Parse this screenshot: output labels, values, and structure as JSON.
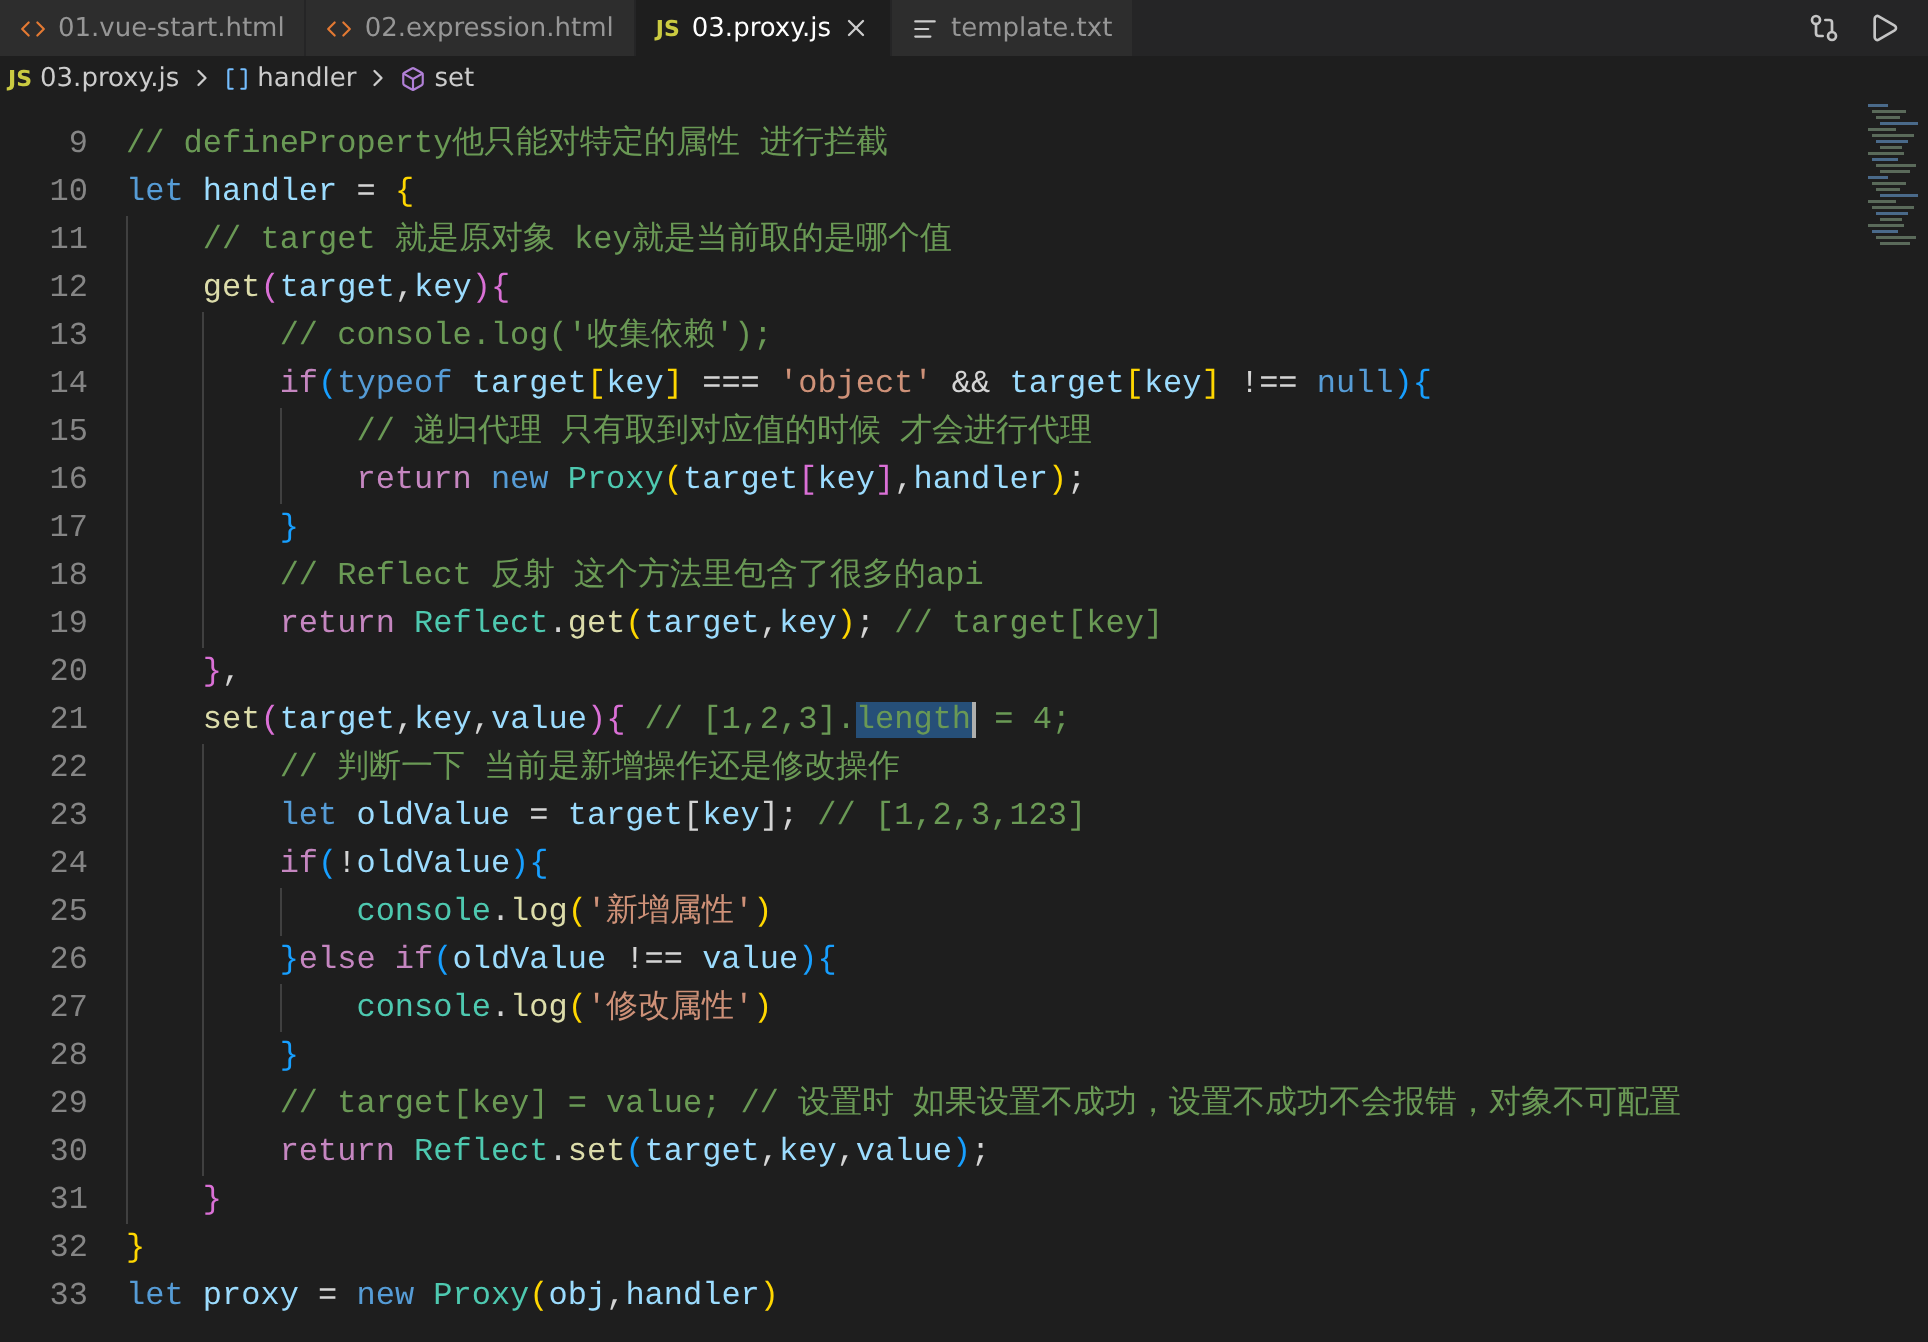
{
  "tabs": [
    {
      "kind": "html",
      "label": "01.vue-start.html",
      "selected": false
    },
    {
      "kind": "html",
      "label": "02.expression.html",
      "selected": false
    },
    {
      "kind": "js",
      "icon_text": "JS",
      "label": "03.proxy.js",
      "selected": true
    },
    {
      "kind": "txt",
      "label": "template.txt",
      "selected": false
    }
  ],
  "breadcrumb": [
    {
      "kind": "file",
      "icon_text": "JS",
      "label": "03.proxy.js"
    },
    {
      "kind": "variable",
      "label": "handler"
    },
    {
      "kind": "method",
      "label": "set"
    }
  ],
  "lines": [
    {
      "number": "9",
      "tokens": [
        {
          "kind": "comment",
          "text": "// defineProperty他只能对特定的属性 进行拦截"
        }
      ]
    },
    {
      "number": "10",
      "tokens": [
        {
          "kind": "keyword",
          "text": "let "
        },
        {
          "kind": "var",
          "text": "handler"
        },
        {
          "kind": "punct",
          "text": " = "
        },
        {
          "kind": "b1",
          "text": "{"
        }
      ]
    },
    {
      "number": "11",
      "tokens": [
        {
          "kind": "comment",
          "text": "    // target 就是原对象 key就是当前取的是哪个值"
        }
      ]
    },
    {
      "number": "12",
      "tokens": [
        {
          "kind": "fn",
          "text": "    get"
        },
        {
          "kind": "b2",
          "text": "("
        },
        {
          "kind": "var",
          "text": "target"
        },
        {
          "kind": "punct",
          "text": ","
        },
        {
          "kind": "var",
          "text": "key"
        },
        {
          "kind": "b2",
          "text": "){"
        }
      ]
    },
    {
      "number": "13",
      "tokens": [
        {
          "kind": "comment",
          "text": "        // console.log('收集依赖');"
        }
      ]
    },
    {
      "number": "14",
      "tokens": [
        {
          "kind": "control",
          "text": "        if"
        },
        {
          "kind": "b3",
          "text": "("
        },
        {
          "kind": "keyword",
          "text": "typeof "
        },
        {
          "kind": "var",
          "text": "target"
        },
        {
          "kind": "b1",
          "text": "["
        },
        {
          "kind": "var",
          "text": "key"
        },
        {
          "kind": "b1",
          "text": "]"
        },
        {
          "kind": "punct",
          "text": " === "
        },
        {
          "kind": "string",
          "text": "'object'"
        },
        {
          "kind": "punct",
          "text": " && "
        },
        {
          "kind": "var",
          "text": "target"
        },
        {
          "kind": "b1",
          "text": "["
        },
        {
          "kind": "var",
          "text": "key"
        },
        {
          "kind": "b1",
          "text": "]"
        },
        {
          "kind": "punct",
          "text": " !== "
        },
        {
          "kind": "keyword",
          "text": "null"
        },
        {
          "kind": "b3",
          "text": "){"
        }
      ]
    },
    {
      "number": "15",
      "tokens": [
        {
          "kind": "comment",
          "text": "            // 递归代理 只有取到对应值的时候 才会进行代理"
        }
      ]
    },
    {
      "number": "16",
      "tokens": [
        {
          "kind": "control",
          "text": "            return "
        },
        {
          "kind": "keyword",
          "text": "new "
        },
        {
          "kind": "class",
          "text": "Proxy"
        },
        {
          "kind": "b1",
          "text": "("
        },
        {
          "kind": "var",
          "text": "target"
        },
        {
          "kind": "b2",
          "text": "["
        },
        {
          "kind": "var",
          "text": "key"
        },
        {
          "kind": "b2",
          "text": "]"
        },
        {
          "kind": "punct",
          "text": ","
        },
        {
          "kind": "var",
          "text": "handler"
        },
        {
          "kind": "b1",
          "text": ")"
        },
        {
          "kind": "punct",
          "text": ";"
        }
      ]
    },
    {
      "number": "17",
      "tokens": [
        {
          "kind": "b3",
          "text": "        }"
        }
      ]
    },
    {
      "number": "18",
      "tokens": [
        {
          "kind": "comment",
          "text": "        // Reflect 反射 这个方法里包含了很多的api"
        }
      ]
    },
    {
      "number": "19",
      "tokens": [
        {
          "kind": "control",
          "text": "        return "
        },
        {
          "kind": "class",
          "text": "Reflect"
        },
        {
          "kind": "punct",
          "text": "."
        },
        {
          "kind": "fn",
          "text": "get"
        },
        {
          "kind": "b1",
          "text": "("
        },
        {
          "kind": "var",
          "text": "target"
        },
        {
          "kind": "punct",
          "text": ","
        },
        {
          "kind": "var",
          "text": "key"
        },
        {
          "kind": "b1",
          "text": ")"
        },
        {
          "kind": "punct",
          "text": ";"
        },
        {
          "kind": "comment",
          "text": " // target[key]"
        }
      ]
    },
    {
      "number": "20",
      "tokens": [
        {
          "kind": "b2",
          "text": "    }"
        },
        {
          "kind": "punct",
          "text": ","
        }
      ]
    },
    {
      "number": "21",
      "tokens": [
        {
          "kind": "fn",
          "text": "    set"
        },
        {
          "kind": "b2",
          "text": "("
        },
        {
          "kind": "var",
          "text": "target"
        },
        {
          "kind": "punct",
          "text": ","
        },
        {
          "kind": "var",
          "text": "key"
        },
        {
          "kind": "punct",
          "text": ","
        },
        {
          "kind": "var",
          "text": "value"
        },
        {
          "kind": "b2",
          "text": "){"
        },
        {
          "kind": "comment",
          "text": " // [1,2,3]."
        },
        {
          "kind": "selection",
          "text": "length"
        },
        {
          "kind": "comment",
          "text": " = 4;"
        }
      ]
    },
    {
      "number": "22",
      "tokens": [
        {
          "kind": "comment",
          "text": "        // 判断一下 当前是新增操作还是修改操作"
        }
      ]
    },
    {
      "number": "23",
      "tokens": [
        {
          "kind": "keyword",
          "text": "        let "
        },
        {
          "kind": "var",
          "text": "oldValue"
        },
        {
          "kind": "punct",
          "text": " = "
        },
        {
          "kind": "var",
          "text": "target"
        },
        {
          "kind": "punct",
          "text": "["
        },
        {
          "kind": "var",
          "text": "key"
        },
        {
          "kind": "punct",
          "text": "];"
        },
        {
          "kind": "comment",
          "text": " // [1,2,3,123]"
        }
      ]
    },
    {
      "number": "24",
      "tokens": [
        {
          "kind": "control",
          "text": "        if"
        },
        {
          "kind": "b3",
          "text": "("
        },
        {
          "kind": "punct",
          "text": "!"
        },
        {
          "kind": "var",
          "text": "oldValue"
        },
        {
          "kind": "b3",
          "text": "){"
        }
      ]
    },
    {
      "number": "25",
      "tokens": [
        {
          "kind": "class",
          "text": "            console"
        },
        {
          "kind": "punct",
          "text": "."
        },
        {
          "kind": "fn",
          "text": "log"
        },
        {
          "kind": "b1",
          "text": "("
        },
        {
          "kind": "string",
          "text": "'新增属性'"
        },
        {
          "kind": "b1",
          "text": ")"
        }
      ]
    },
    {
      "number": "26",
      "tokens": [
        {
          "kind": "b3",
          "text": "        }"
        },
        {
          "kind": "control",
          "text": "else if"
        },
        {
          "kind": "b3",
          "text": "("
        },
        {
          "kind": "var",
          "text": "oldValue"
        },
        {
          "kind": "punct",
          "text": " !== "
        },
        {
          "kind": "var",
          "text": "value"
        },
        {
          "kind": "b3",
          "text": "){"
        }
      ]
    },
    {
      "number": "27",
      "tokens": [
        {
          "kind": "class",
          "text": "            console"
        },
        {
          "kind": "punct",
          "text": "."
        },
        {
          "kind": "fn",
          "text": "log"
        },
        {
          "kind": "b1",
          "text": "("
        },
        {
          "kind": "string",
          "text": "'修改属性'"
        },
        {
          "kind": "b1",
          "text": ")"
        }
      ]
    },
    {
      "number": "28",
      "tokens": [
        {
          "kind": "b3",
          "text": "        }"
        }
      ]
    },
    {
      "number": "29",
      "tokens": [
        {
          "kind": "comment",
          "text": "        // target[key] = value; // 设置时 如果设置不成功，设置不成功不会报错，对象不可配置"
        }
      ]
    },
    {
      "number": "30",
      "tokens": [
        {
          "kind": "control",
          "text": "        return "
        },
        {
          "kind": "class",
          "text": "Reflect"
        },
        {
          "kind": "punct",
          "text": "."
        },
        {
          "kind": "fn",
          "text": "set"
        },
        {
          "kind": "b3",
          "text": "("
        },
        {
          "kind": "var",
          "text": "target"
        },
        {
          "kind": "punct",
          "text": ","
        },
        {
          "kind": "var",
          "text": "key"
        },
        {
          "kind": "punct",
          "text": ","
        },
        {
          "kind": "var",
          "text": "value"
        },
        {
          "kind": "b3",
          "text": ")"
        },
        {
          "kind": "punct",
          "text": ";"
        }
      ]
    },
    {
      "number": "31",
      "tokens": [
        {
          "kind": "b2",
          "text": "    }"
        }
      ]
    },
    {
      "number": "32",
      "tokens": [
        {
          "kind": "b1",
          "text": "}"
        }
      ]
    },
    {
      "number": "33",
      "tokens": [
        {
          "kind": "keyword",
          "text": "let "
        },
        {
          "kind": "var",
          "text": "proxy"
        },
        {
          "kind": "punct",
          "text": " = "
        },
        {
          "kind": "keyword",
          "text": "new "
        },
        {
          "kind": "class",
          "text": "Proxy"
        },
        {
          "kind": "b1",
          "text": "("
        },
        {
          "kind": "var",
          "text": "obj"
        },
        {
          "kind": "punct",
          "text": ","
        },
        {
          "kind": "var",
          "text": "handler"
        },
        {
          "kind": "b1",
          "text": ")"
        }
      ]
    }
  ]
}
